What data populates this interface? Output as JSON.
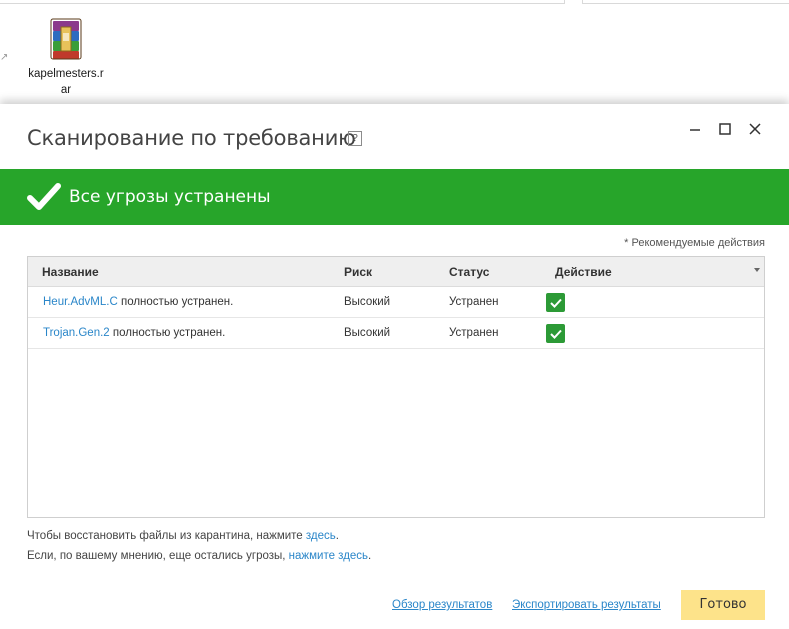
{
  "desktop": {
    "file_label": "kapelmesters.rar",
    "file_icon": "winrar-archive-icon"
  },
  "dialog": {
    "title": "Сканирование по требованию",
    "help_label": "?",
    "banner_text": "Все угрозы устранены",
    "banner_color": "#27a52a",
    "recommended_note": "* Рекомендуемые действия",
    "table": {
      "headers": {
        "name": "Название",
        "risk": "Риск",
        "status": "Статус",
        "action": "Действие"
      },
      "rows": [
        {
          "threat": "Heur.AdvML.C",
          "suffix": " полностью устранен.",
          "risk": "Высокий",
          "status": "Устранен",
          "action_checked": true
        },
        {
          "threat": "Trojan.Gen.2",
          "suffix": " полностью устранен.",
          "risk": "Высокий",
          "status": "Устранен",
          "action_checked": true
        }
      ]
    },
    "footer": {
      "line1_text": "Чтобы восстановить файлы из карантина, нажмите ",
      "line1_link": "здесь",
      "line1_end": ".",
      "line2_text": "Если, по вашему мнению, еще остались угрозы, ",
      "line2_link": "нажмите здесь",
      "line2_end": "."
    },
    "buttons": {
      "overview": "Обзор результатов",
      "export": "Экспортировать результаты",
      "done": "Готово"
    },
    "accent_link_color": "#2a86c9",
    "done_button_color": "#fde38a"
  }
}
